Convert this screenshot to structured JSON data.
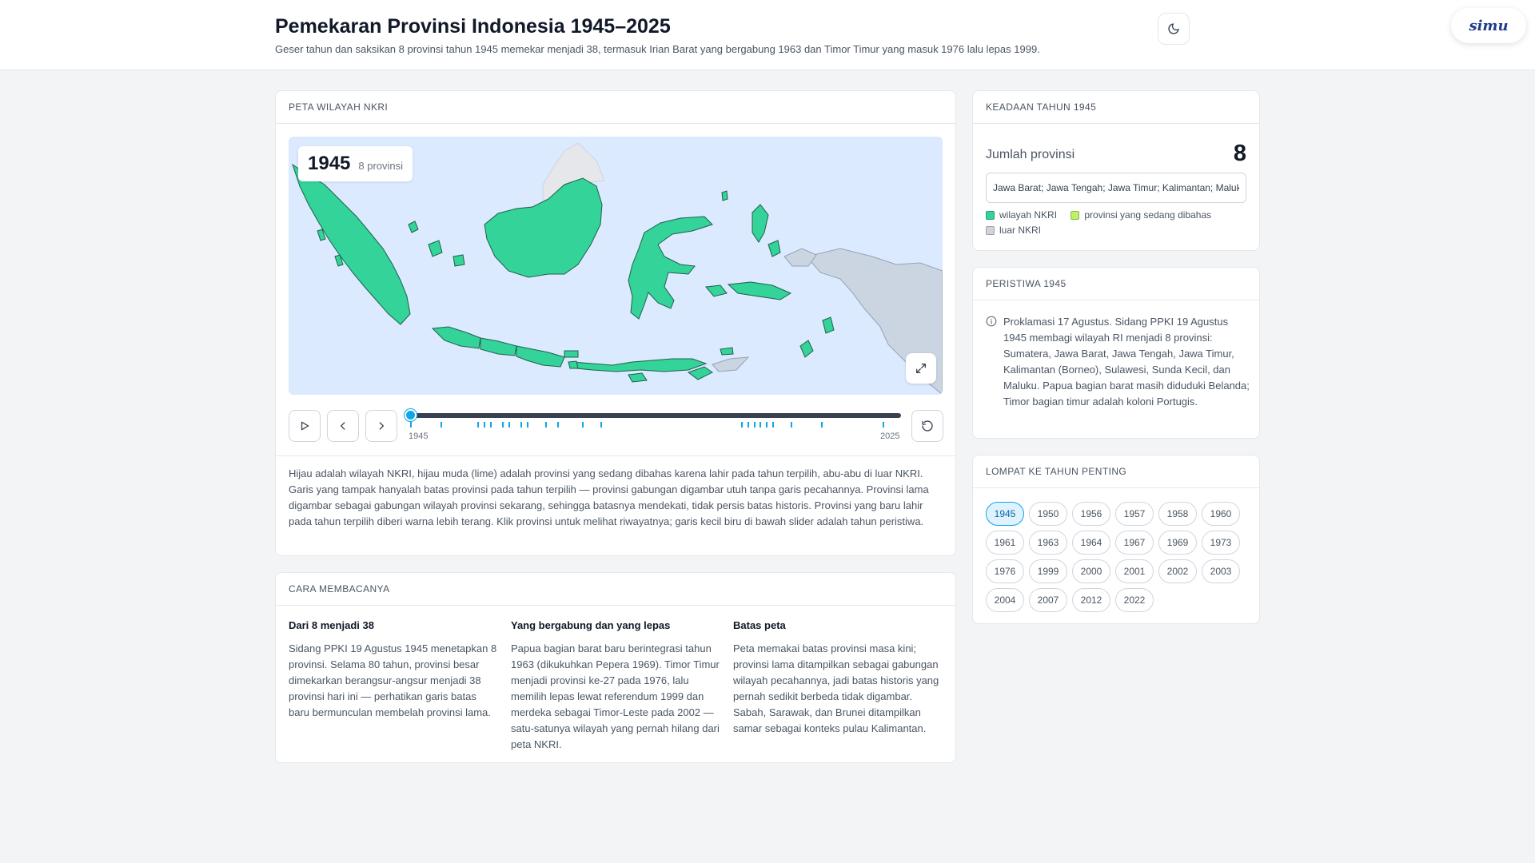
{
  "header": {
    "title": "Pemekaran Provinsi Indonesia 1945–2025",
    "subtitle": "Geser tahun dan saksikan 8 provinsi tahun 1945 memekar menjadi 38, termasuk Irian Barat yang bergabung 1963 dan Timor Timur yang masuk 1976 lalu lepas 1999.",
    "brand": "simu",
    "theme_icon": "moon-icon"
  },
  "map_card": {
    "heading": "PETA WILAYAH NKRI",
    "year": "1945",
    "province_count_label": "8 provinsi",
    "slider": {
      "min_label": "1945",
      "max_label": "2025",
      "value": 1945,
      "min": 1945,
      "max": 2025
    },
    "event_years": [
      1945,
      1950,
      1956,
      1957,
      1958,
      1960,
      1961,
      1963,
      1964,
      1967,
      1969,
      1973,
      1976,
      1999,
      2000,
      2001,
      2002,
      2003,
      2004,
      2007,
      2012,
      2022
    ],
    "description": "Hijau adalah wilayah NKRI, hijau muda (lime) adalah provinsi yang sedang dibahas karena lahir pada tahun terpilih, abu-abu di luar NKRI. Garis yang tampak hanyalah batas provinsi pada tahun terpilih — provinsi gabungan digambar utuh tanpa garis pecahannya. Provinsi lama digambar sebagai gabungan wilayah provinsi sekarang, sehingga batasnya mendekati, tidak persis batas historis. Provinsi yang baru lahir pada tahun terpilih diberi warna lebih terang. Klik provinsi untuk melihat riwayatnya; garis kecil biru di bawah slider adalah tahun peristiwa.",
    "colors": {
      "nkri": "#34d399",
      "discussed": "#bef264",
      "outside": "#d1d5db",
      "sea": "#dbeafe",
      "accent": "#0ea5e9"
    }
  },
  "howto": {
    "heading": "CARA MEMBACANYA",
    "columns": [
      {
        "title": "Dari 8 menjadi 38",
        "text": "Sidang PPKI 19 Agustus 1945 menetapkan 8 provinsi. Selama 80 tahun, provinsi besar dimekarkan berangsur-angsur menjadi 38 provinsi hari ini — perhatikan garis batas baru bermunculan membelah provinsi lama."
      },
      {
        "title": "Yang bergabung dan yang lepas",
        "text": "Papua bagian barat baru berintegrasi tahun 1963 (dikukuhkan Pepera 1969). Timor Timur menjadi provinsi ke-27 pada 1976, lalu memilih lepas lewat referendum 1999 dan merdeka sebagai Timor-Leste pada 2002 — satu-satunya wilayah yang pernah hilang dari peta NKRI."
      },
      {
        "title": "Batas peta",
        "text": "Peta memakai batas provinsi masa kini; provinsi lama ditampilkan sebagai gabungan wilayah pecahannya, jadi batas historis yang pernah sedikit berbeda tidak digambar. Sabah, Sarawak, dan Brunei ditampilkan samar sebagai konteks pulau Kalimantan."
      }
    ]
  },
  "state": {
    "heading": "KEADAAN TAHUN 1945",
    "count_label": "Jumlah provinsi",
    "count_value": "8",
    "provinces_value": "Jawa Barat; Jawa Tengah; Jawa Timur; Kalimantan; Maluku; Sulawesi; Sumatera; Sunda Kecil",
    "legend": [
      {
        "label": "wilayah NKRI",
        "color": "#34d399"
      },
      {
        "label": "provinsi yang sedang dibahas",
        "color": "#bef264"
      },
      {
        "label": "luar NKRI",
        "color": "#d1d5db"
      }
    ]
  },
  "event": {
    "heading": "PERISTIWA 1945",
    "icon": "info-icon",
    "text": "Proklamasi 17 Agustus. Sidang PPKI 19 Agustus 1945 membagi wilayah RI menjadi 8 provinsi: Sumatera, Jawa Barat, Jawa Tengah, Jawa Timur, Kalimantan (Borneo), Sulawesi, Sunda Kecil, dan Maluku. Papua bagian barat masih diduduki Belanda; Timor bagian timur adalah koloni Portugis."
  },
  "jump": {
    "heading": "LOMPAT KE TAHUN PENTING",
    "years": [
      "1945",
      "1950",
      "1956",
      "1957",
      "1958",
      "1960",
      "1961",
      "1963",
      "1964",
      "1967",
      "1969",
      "1973",
      "1976",
      "1999",
      "2000",
      "2001",
      "2002",
      "2003",
      "2004",
      "2007",
      "2012",
      "2022"
    ],
    "active": "1945"
  }
}
